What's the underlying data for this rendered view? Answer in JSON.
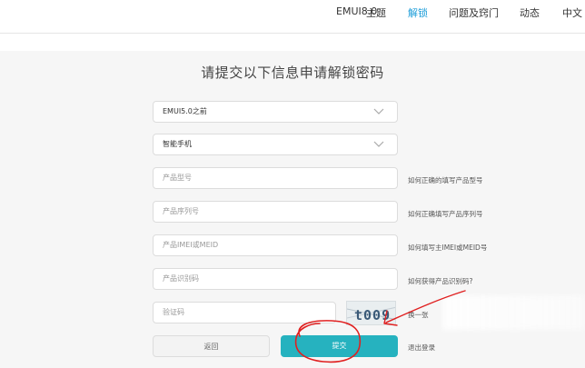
{
  "nav": {
    "items": [
      {
        "label": "EMUI8.0"
      },
      {
        "label": "主题"
      },
      {
        "label": "解锁"
      },
      {
        "label": "问题及窍门"
      },
      {
        "label": "动态"
      },
      {
        "label": "中文"
      }
    ],
    "active_color": "#1a9cd8"
  },
  "form": {
    "title": "请提交以下信息申请解锁密码",
    "emui_version": {
      "value": "EMUI5.0之前"
    },
    "device_type": {
      "value": "智能手机"
    },
    "product_model": {
      "placeholder": "产品型号",
      "help": "如何正确的填写产品型号"
    },
    "serial_number": {
      "placeholder": "产品序列号",
      "help": "如何正确填写产品序列号"
    },
    "imei": {
      "placeholder": "产品IMEI或MEID",
      "help": "如何填写主IMEI或MEID号"
    },
    "product_id": {
      "placeholder": "产品识别码",
      "help": "如何获得产品识别码?"
    },
    "captcha": {
      "placeholder": "验证码",
      "image_text": "t009",
      "refresh_label": "换一张"
    },
    "back_label": "返回",
    "submit_label": "提交",
    "logout_label": "退出登录"
  },
  "colors": {
    "submit": "#26b2bf",
    "annotation": "#e02020",
    "panel": "#f6f6f6"
  }
}
